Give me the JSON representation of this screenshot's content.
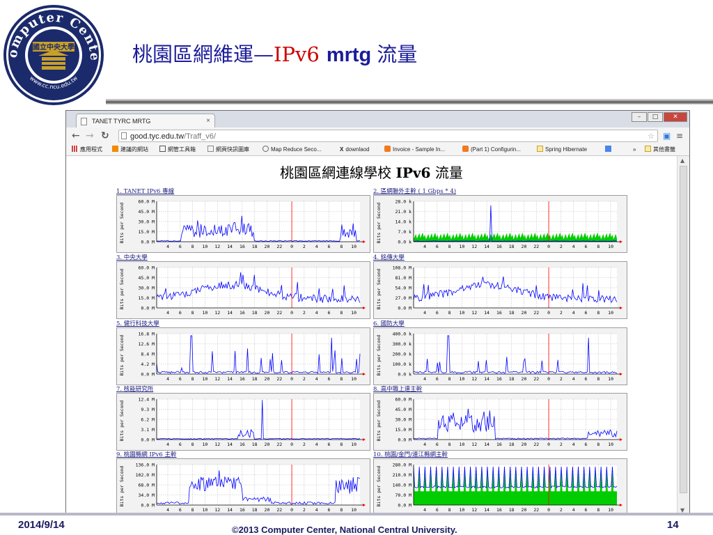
{
  "slide": {
    "title_cjk": "桃園區網維運—",
    "title_ipv6": "IPv6",
    "title_mrtg": "mrtg",
    "title_tail": "流量",
    "logo_text": "Computer Center",
    "logo_url": "www.cc.ncu.edu.tw",
    "logo_badge": "國立中央大學",
    "footer_date": "2014/9/14",
    "footer_copyright": "©2013 Computer Center, National Central University.",
    "page_number": "14"
  },
  "browser": {
    "tab_title": "TANET TYRC MRTG",
    "url_host": "good.tyc.edu.tw",
    "url_path": "/Traff_v6/",
    "bookmarks": [
      {
        "label": "應用程式",
        "icon": "apps-grid-icon"
      },
      {
        "label": "建議的網站",
        "icon": "bookmark-icon"
      },
      {
        "label": "網管工具箱",
        "icon": "chart-icon"
      },
      {
        "label": "網頁快訊圖庫",
        "icon": "page-icon"
      },
      {
        "label": "Map Reduce Seco...",
        "icon": "wordpress-icon"
      },
      {
        "label": "downlaod",
        "icon": "x-icon"
      },
      {
        "label": "Invoice - Sample In...",
        "icon": "blogger-icon"
      },
      {
        "label": "(Part 1) Configurin...",
        "icon": "blogger-icon"
      },
      {
        "label": "Spring Hibernate",
        "icon": "folder-icon"
      },
      {
        "label": "»",
        "icon": ""
      },
      {
        "label": "其他書籤",
        "icon": "folder-icon"
      }
    ]
  },
  "page": {
    "heading_cjk": "桃園區網連線學校",
    "heading_ip": "IPv6",
    "heading_tail": "流量"
  },
  "chart_data": [
    {
      "type": "area",
      "title": "1. TANET IPv6 專線",
      "ylabel": "Bits per Second",
      "ytick_labels": [
        "60.0 M",
        "45.0 M",
        "30.0 M",
        "15.0 M",
        "0.0 M"
      ],
      "x_tick_labels": [
        "4",
        "6",
        "8",
        "10",
        "12",
        "14",
        "16",
        "18",
        "20",
        "22",
        "0",
        "2",
        "4",
        "6",
        "8",
        "10"
      ],
      "traffic": "bursty_two",
      "green_base": false
    },
    {
      "type": "area",
      "title": "2. 區網聯外主幹 ( 1 Gbps * 4)",
      "ylabel": "Bits per Second",
      "ytick_labels": [
        "28.0 k",
        "21.0 k",
        "14.0 k",
        "7.0 k",
        "0.0 k"
      ],
      "x_tick_labels": [
        "4",
        "6",
        "8",
        "10",
        "12",
        "14",
        "16",
        "18",
        "20",
        "22",
        "0",
        "2",
        "4",
        "6",
        "8",
        "10"
      ],
      "traffic": "green_spike",
      "green_base": true
    },
    {
      "type": "area",
      "title": "3. 中央大學",
      "ylabel": "Bits per Second",
      "ytick_labels": [
        "60.0 M",
        "45.0 M",
        "30.0 M",
        "15.0 M",
        "0.0 M"
      ],
      "x_tick_labels": [
        "4",
        "6",
        "8",
        "10",
        "12",
        "14",
        "16",
        "18",
        "20",
        "22",
        "0",
        "2",
        "4",
        "6",
        "8",
        "10"
      ],
      "traffic": "noisy_day",
      "green_base": false
    },
    {
      "type": "area",
      "title": "4. 銘傳大學",
      "ylabel": "Bits per Second",
      "ytick_labels": [
        "108.0 M",
        "81.0 M",
        "54.0 M",
        "27.0 M",
        "0.0 M"
      ],
      "x_tick_labels": [
        "4",
        "6",
        "8",
        "10",
        "12",
        "14",
        "16",
        "18",
        "20",
        "22",
        "0",
        "2",
        "4",
        "6",
        "8",
        "10"
      ],
      "traffic": "noisy_day",
      "green_base": false
    },
    {
      "type": "area",
      "title": "5. 健行科技大學",
      "ylabel": "Bits per Second",
      "ytick_labels": [
        "16.8 M",
        "12.6 M",
        "8.4 M",
        "4.2 M",
        "0.0 M"
      ],
      "x_tick_labels": [
        "4",
        "6",
        "8",
        "10",
        "12",
        "14",
        "16",
        "18",
        "20",
        "22",
        "0",
        "2",
        "4",
        "6",
        "8",
        "10"
      ],
      "traffic": "sparse_spikes",
      "green_base": false
    },
    {
      "type": "area",
      "title": "6. 國防大學",
      "ylabel": "Bits per Second",
      "ytick_labels": [
        "400.0 k",
        "300.0 k",
        "200.0 k",
        "100.0 k",
        "0.0 k"
      ],
      "x_tick_labels": [
        "4",
        "6",
        "8",
        "10",
        "12",
        "14",
        "16",
        "18",
        "20",
        "22",
        "0",
        "2",
        "4",
        "6",
        "8",
        "10"
      ],
      "traffic": "sparse_spikes",
      "green_base": false
    },
    {
      "type": "area",
      "title": "7. 核能研究所",
      "ylabel": "Bits per Second",
      "ytick_labels": [
        "12.4 M",
        "9.3 M",
        "6.2 M",
        "3.1 M",
        "0.0 M"
      ],
      "x_tick_labels": [
        "4",
        "6",
        "8",
        "10",
        "12",
        "14",
        "16",
        "18",
        "20",
        "22",
        "0",
        "2",
        "4",
        "6",
        "8",
        "10"
      ],
      "traffic": "single_spike",
      "green_base": false
    },
    {
      "type": "area",
      "title": "8. 高中職上連主幹",
      "ylabel": "Bits per Second",
      "ytick_labels": [
        "60.0 M",
        "45.0 M",
        "30.0 M",
        "15.0 M",
        "0.0 M"
      ],
      "x_tick_labels": [
        "4",
        "6",
        "8",
        "10",
        "12",
        "14",
        "16",
        "18",
        "20",
        "22",
        "0",
        "2",
        "4",
        "6",
        "8",
        "10"
      ],
      "traffic": "midday_block",
      "green_base": false
    },
    {
      "type": "area",
      "title": "9. 桃園縣網 IPv6 主幹",
      "ylabel": "Bits per Second",
      "ytick_labels": [
        "136.0 M",
        "102.0 M",
        "68.0 M",
        "34.0 M",
        "0.0 M"
      ],
      "x_tick_labels": [
        "4",
        "6",
        "8",
        "10",
        "12",
        "14",
        "16",
        "18",
        "20",
        "22",
        "0",
        "2",
        "4",
        "6",
        "8",
        "10"
      ],
      "traffic": "busy_block",
      "green_base": false
    },
    {
      "type": "area",
      "title": "10. 桃園/金門/連江縣網主幹",
      "ylabel": "Bits per Second",
      "ytick_labels": [
        "280.0 M",
        "210.0 M",
        "140.0 M",
        "70.0 M",
        "0.0 M"
      ],
      "x_tick_labels": [
        "4",
        "6",
        "8",
        "10",
        "12",
        "14",
        "16",
        "18",
        "20",
        "22",
        "0",
        "2",
        "4",
        "6",
        "8",
        "10"
      ],
      "traffic": "green_periodic",
      "green_base": true
    }
  ],
  "colors": {
    "title_blue": "#1c1c9a",
    "title_red": "#cc0000",
    "footer_blue": "#1a1a60",
    "graph_in_green": "#00cc00",
    "graph_out_blue": "#0000ff",
    "now_line_red": "#ff0000",
    "grid": "#bbbbbb",
    "panel_title_link": "#1a1a80"
  }
}
